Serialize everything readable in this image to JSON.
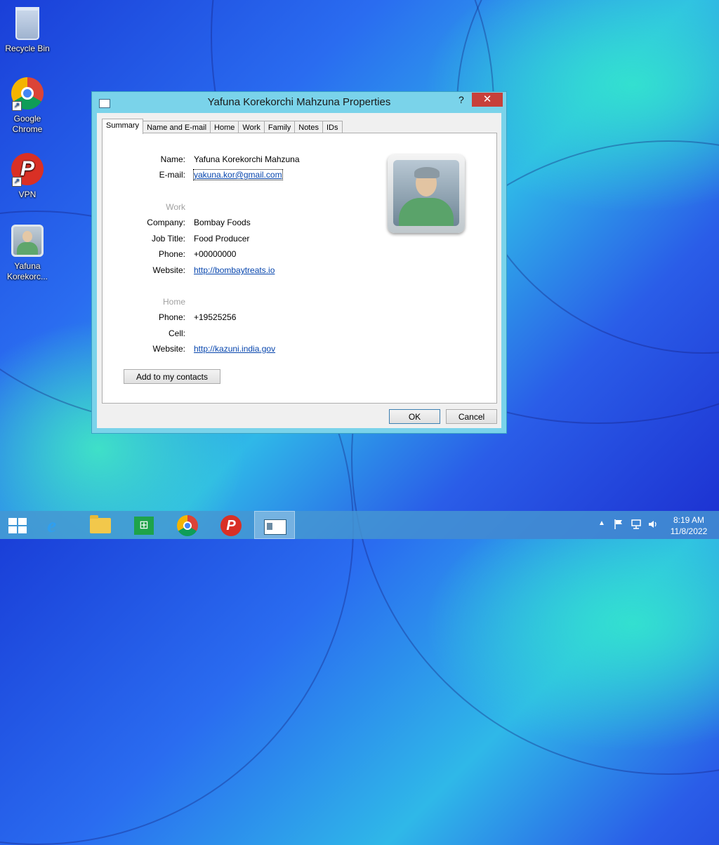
{
  "desktop": {
    "icons": [
      {
        "label": "Recycle Bin"
      },
      {
        "label": "Google Chrome"
      },
      {
        "label": "VPN"
      },
      {
        "label": "Yafuna Korekorc..."
      }
    ]
  },
  "dialog": {
    "title": "Yafuna Korekorchi Mahzuna Properties",
    "help": "?",
    "close": "✕",
    "tabs": [
      "Summary",
      "Name and E-mail",
      "Home",
      "Work",
      "Family",
      "Notes",
      "IDs"
    ],
    "active_tab": "Summary",
    "summary": {
      "name_label": "Name:",
      "name_value": "Yafuna Korekorchi Mahzuna",
      "email_label": "E-mail:",
      "email_value": "yakuna.kor@gmail.com",
      "work_heading": "Work",
      "company_label": "Company:",
      "company_value": "Bombay Foods",
      "jobtitle_label": "Job Title:",
      "jobtitle_value": "Food Producer",
      "work_phone_label": "Phone:",
      "work_phone_value": "+00000000",
      "work_website_label": "Website:",
      "work_website_value": "http://bombaytreats.io",
      "home_heading": "Home",
      "home_phone_label": "Phone:",
      "home_phone_value": "+19525256",
      "cell_label": "Cell:",
      "cell_value": "",
      "home_website_label": "Website:",
      "home_website_value": "http://kazuni.india.gov"
    },
    "add_contact_button": "Add to my contacts",
    "ok_button": "OK",
    "cancel_button": "Cancel"
  },
  "taskbar": {
    "time": "8:19 AM",
    "date": "11/8/2022"
  }
}
